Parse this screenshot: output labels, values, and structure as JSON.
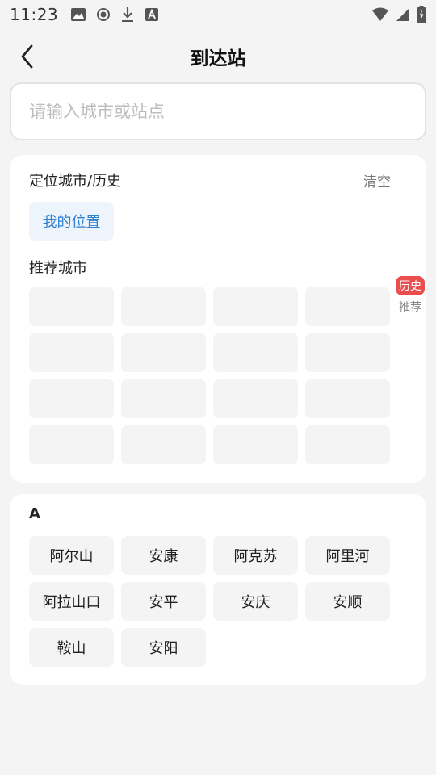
{
  "status_bar": {
    "time": "11:23",
    "left_icons": [
      "image-icon",
      "record-icon",
      "download-icon",
      "font-icon"
    ],
    "right_icons": [
      "wifi-icon",
      "signal-icon",
      "battery-icon"
    ]
  },
  "header": {
    "title": "到达站",
    "back_icon": "chevron-left-icon"
  },
  "search": {
    "placeholder": "请输入城市或站点",
    "value": ""
  },
  "location_section": {
    "title": "定位城市/历史",
    "clear_label": "清空",
    "my_location_label": "我的位置"
  },
  "recommended_section": {
    "title": "推荐城市",
    "placeholder_count": 16
  },
  "side_index": [
    {
      "label": "历史",
      "active": true
    },
    {
      "label": "推荐",
      "active": false
    }
  ],
  "city_groups": [
    {
      "letter": "A",
      "cities": [
        "阿尔山",
        "安康",
        "阿克苏",
        "阿里河",
        "阿拉山口",
        "安平",
        "安庆",
        "安顺",
        "鞍山",
        "安阳"
      ]
    }
  ],
  "colors": {
    "background": "#f4f4f4",
    "card": "#ffffff",
    "accent_blue": "#2f80d1",
    "badge_red": "#ea4e4e"
  }
}
